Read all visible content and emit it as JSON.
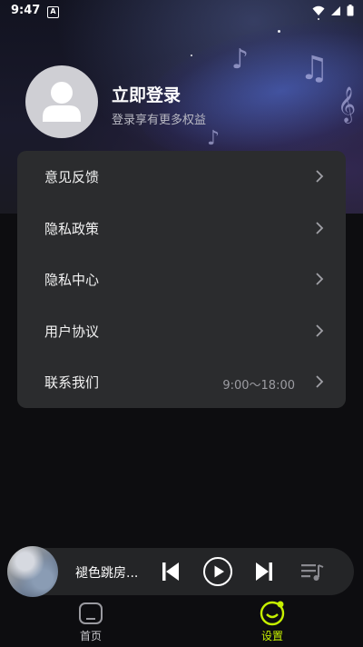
{
  "status_bar": {
    "time": "9:47",
    "notification_badge": "A",
    "icons": [
      "wifi-icon",
      "signal-icon",
      "battery-icon"
    ]
  },
  "profile": {
    "title": "立即登录",
    "subtitle": "登录享有更多权益"
  },
  "menu": {
    "items": [
      {
        "label": "意见反馈",
        "extra": ""
      },
      {
        "label": "隐私政策",
        "extra": ""
      },
      {
        "label": "隐私中心",
        "extra": ""
      },
      {
        "label": "用户协议",
        "extra": ""
      },
      {
        "label": "联系我们",
        "extra": "9:00～18:00"
      }
    ]
  },
  "player": {
    "song_title": "褪色跳房...",
    "controls": [
      "previous-icon",
      "play-icon",
      "next-icon",
      "playlist-icon"
    ]
  },
  "bottom_nav": {
    "items": [
      {
        "label": "首页",
        "active": false
      },
      {
        "label": "设置",
        "active": true
      }
    ]
  },
  "colors": {
    "accent": "#c6f000",
    "card": "#2b2c2e",
    "background": "#0d0d10"
  }
}
